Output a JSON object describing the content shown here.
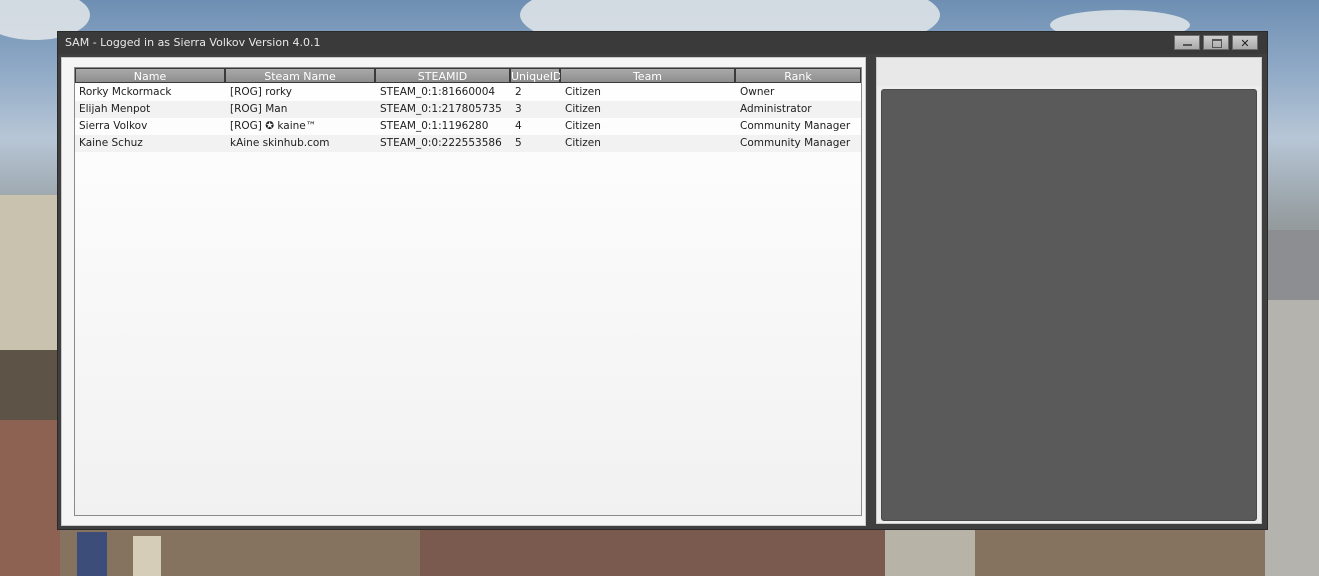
{
  "window": {
    "title": "SAM - Logged in as Sierra Volkov Version 4.0.1",
    "controls": {
      "minimize": "minimize",
      "maximize": "maximize",
      "close": "✕"
    }
  },
  "table": {
    "columns": [
      "Name",
      "Steam Name",
      "STEAMID",
      "UniqueID",
      "Team",
      "Rank"
    ],
    "rows": [
      [
        "Rorky Mckormack",
        "[ROG] rorky",
        "STEAM_0:1:81660004",
        "2",
        "Citizen",
        "Owner"
      ],
      [
        "Elijah Menpot",
        "[ROG] Man",
        "STEAM_0:1:217805735",
        "3",
        "Citizen",
        "Administrator"
      ],
      [
        "Sierra Volkov",
        "[ROG] ✪ kaine™",
        "STEAM_0:1:1196280",
        "4",
        "Citizen",
        "Community Manager"
      ],
      [
        "Kaine Schuz",
        "kAine skinhub.com",
        "STEAM_0:0:222553586",
        "5",
        "Citizen",
        "Community Manager"
      ]
    ]
  },
  "colors": {
    "header_bg": "#9b9b9b",
    "window_bg": "#3f3f3f",
    "right_box_bg": "#5a5a5a"
  }
}
